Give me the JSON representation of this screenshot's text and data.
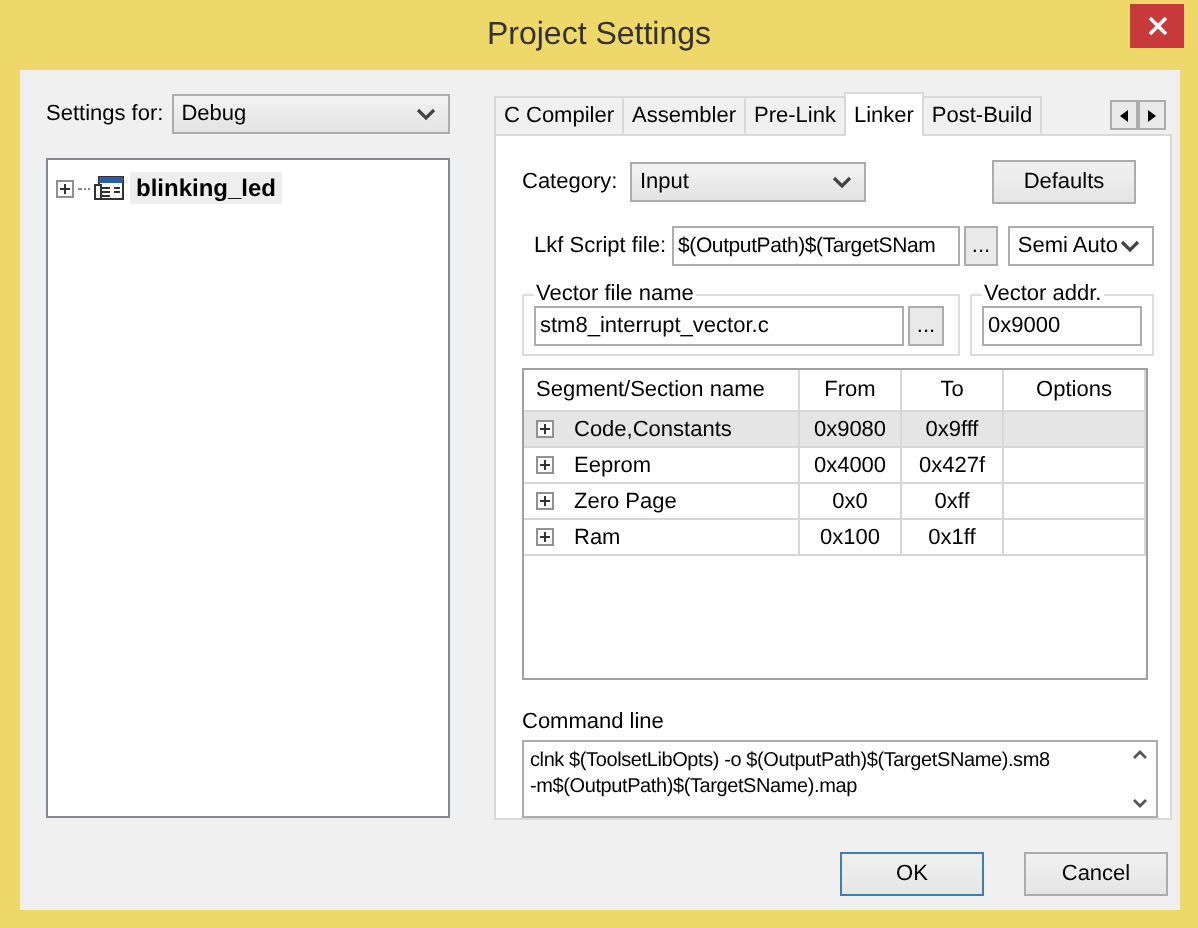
{
  "window": {
    "title": "Project Settings"
  },
  "settings_for": {
    "label": "Settings for:",
    "value": "Debug"
  },
  "tree": {
    "items": [
      {
        "label": "blinking_led",
        "expanded": false,
        "selected": true
      }
    ]
  },
  "tabs": [
    {
      "label": "C Compiler",
      "selected": false
    },
    {
      "label": "Assembler",
      "selected": false
    },
    {
      "label": "Pre-Link",
      "selected": false
    },
    {
      "label": "Linker",
      "selected": true
    },
    {
      "label": "Post-Build",
      "selected": false
    }
  ],
  "linker": {
    "category": {
      "label": "Category:",
      "value": "Input"
    },
    "defaults_button": "Defaults",
    "lkf_script": {
      "label": "Lkf Script file:",
      "value": "$(OutputPath)$(TargetSNam",
      "browse": "...",
      "mode": "Semi Auto"
    },
    "vector_file": {
      "legend": "Vector file name",
      "value": "stm8_interrupt_vector.c",
      "browse": "..."
    },
    "vector_addr": {
      "legend": "Vector addr.",
      "value": "0x9000"
    },
    "segments": {
      "columns": [
        "Segment/Section name",
        "From",
        "To",
        "Options"
      ],
      "rows": [
        {
          "name": "Code,Constants",
          "from": "0x9080",
          "to": "0x9fff",
          "expanded": false,
          "selected": true
        },
        {
          "name": "Eeprom",
          "from": "0x4000",
          "to": "0x427f",
          "expanded": false,
          "selected": false
        },
        {
          "name": "Zero Page",
          "from": "0x0",
          "to": "0xff",
          "expanded": false,
          "selected": false
        },
        {
          "name": "Ram",
          "from": "0x100",
          "to": "0x1ff",
          "expanded": false,
          "selected": false
        }
      ]
    },
    "command_line": {
      "label": "Command line",
      "lines": [
        "clnk $(ToolsetLibOpts) -o $(OutputPath)$(TargetSName).sm8",
        "-m$(OutputPath)$(TargetSName).map"
      ]
    }
  },
  "buttons": [
    {
      "label": "OK",
      "default": true
    },
    {
      "label": "Cancel",
      "default": false
    }
  ]
}
